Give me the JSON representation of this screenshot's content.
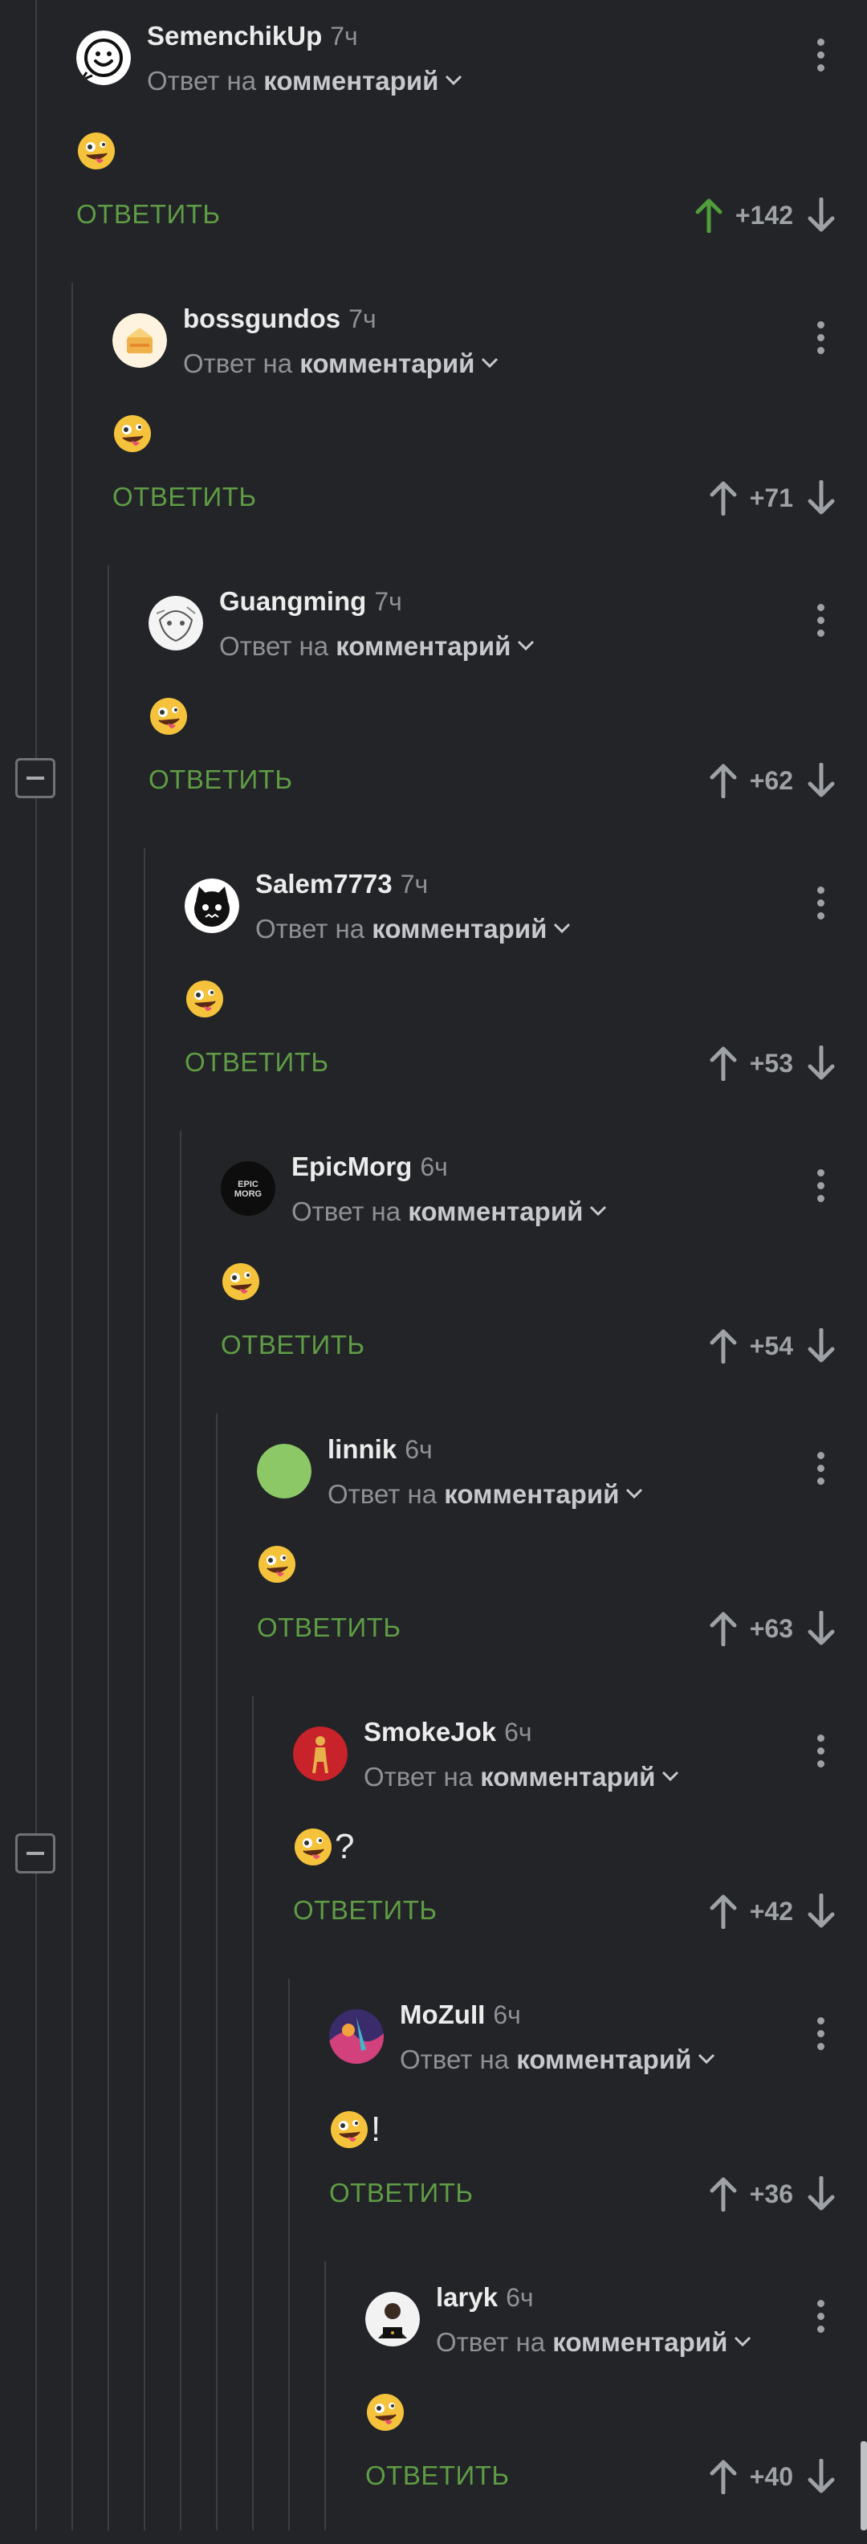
{
  "ui": {
    "reply_prefix": "Ответ на",
    "reply_target": "комментарий",
    "reply_button": "ОТВЕТИТЬ"
  },
  "colors": {
    "background": "#222427",
    "accent_green": "#5f9c45",
    "muted": "#8e9195"
  },
  "comments": [
    {
      "author": "SemenchikUp",
      "time": "7ч",
      "text": "",
      "score": "+142",
      "upvoted": true,
      "avatar": "smiley-avatar"
    },
    {
      "author": "bossgundos",
      "time": "7ч",
      "text": "",
      "score": "+71",
      "upvoted": false,
      "avatar": "cake-avatar"
    },
    {
      "author": "Guangming",
      "time": "7ч",
      "text": "",
      "score": "+62",
      "upvoted": false,
      "avatar": "sketch-avatar"
    },
    {
      "author": "Salem7773",
      "time": "7ч",
      "text": "",
      "score": "+53",
      "upvoted": false,
      "avatar": "cat-avatar"
    },
    {
      "author": "EpicMorg",
      "time": "6ч",
      "text": "",
      "score": "+54",
      "upvoted": false,
      "avatar": "epicmorg-avatar",
      "avatar_text": "EPIC MORG"
    },
    {
      "author": "linnik",
      "time": "6ч",
      "text": "",
      "score": "+63",
      "upvoted": false,
      "avatar": "green-circle-avatar"
    },
    {
      "author": "SmokeJok",
      "time": "6ч",
      "text": "?",
      "score": "+42",
      "upvoted": false,
      "avatar": "red-figure-avatar"
    },
    {
      "author": "MoZuII",
      "time": "6ч",
      "text": "!",
      "score": "+36",
      "upvoted": false,
      "avatar": "colorful-avatar"
    },
    {
      "author": "laryk",
      "time": "6ч",
      "text": "",
      "score": "+40",
      "upvoted": false,
      "avatar": "person-laptop-avatar"
    }
  ]
}
